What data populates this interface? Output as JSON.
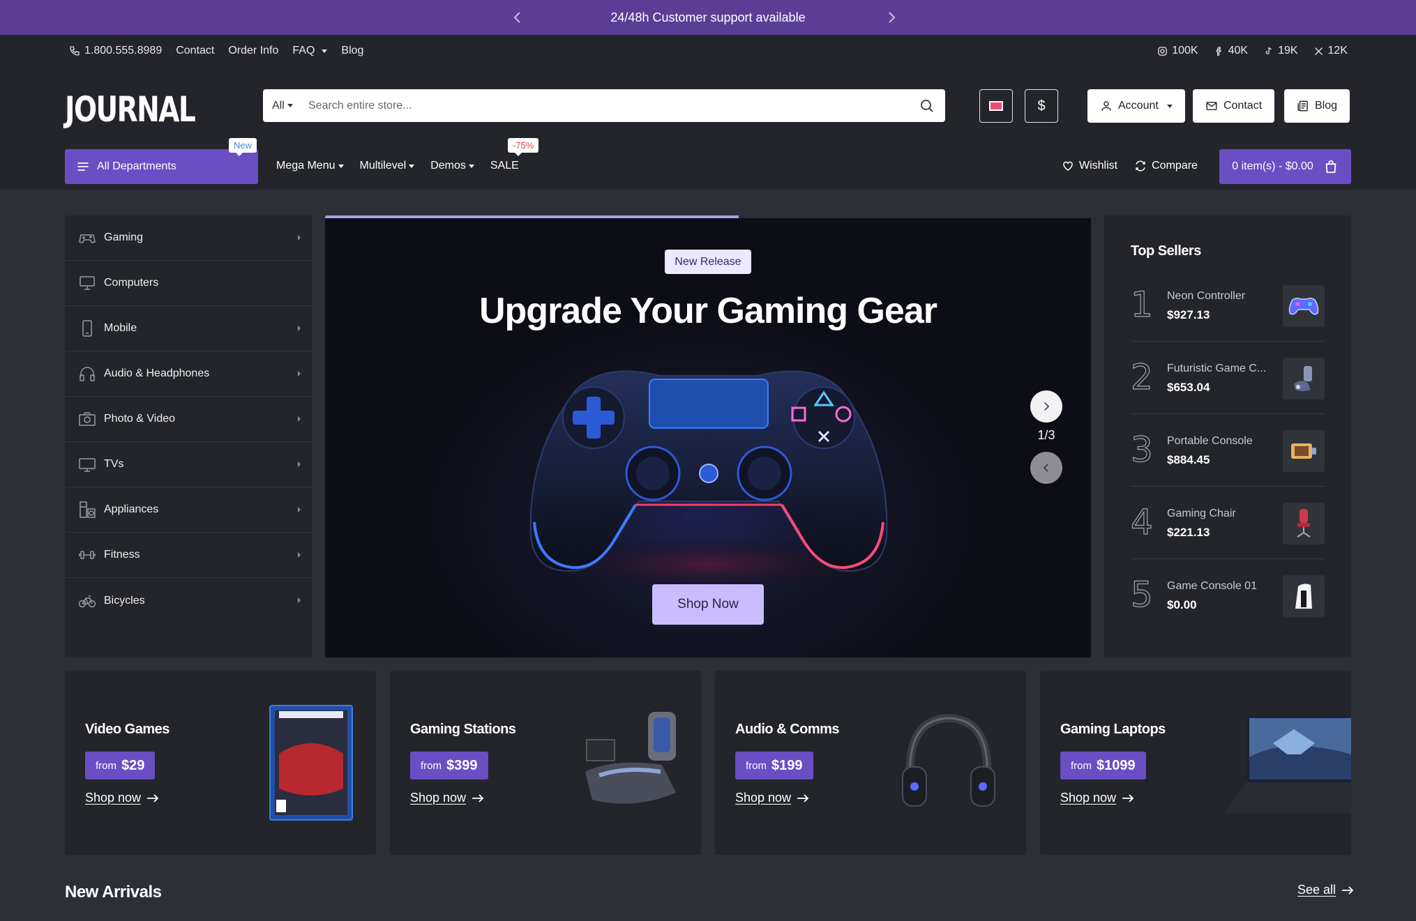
{
  "announcement": {
    "text": "24/48h Customer support available"
  },
  "topbar": {
    "phone": "1.800.555.8989",
    "links": [
      "Contact",
      "Order Info",
      "FAQ",
      "Blog"
    ],
    "social": [
      {
        "icon": "instagram-icon",
        "count": "100K"
      },
      {
        "icon": "facebook-icon",
        "count": "40K"
      },
      {
        "icon": "tiktok-icon",
        "count": "19K"
      },
      {
        "icon": "x-icon",
        "count": "12K"
      }
    ]
  },
  "header": {
    "logo": "JOURNAL",
    "search": {
      "category": "All",
      "placeholder": "Search entire store..."
    },
    "currency": "$",
    "buttons": {
      "account": "Account",
      "contact": "Contact",
      "blog": "Blog"
    }
  },
  "nav": {
    "departments": "All Departments",
    "departments_badge": "New",
    "items": [
      "Mega Menu",
      "Multilevel",
      "Demos",
      "SALE"
    ],
    "sale_badge": "-75%",
    "wishlist": "Wishlist",
    "compare": "Compare",
    "cart": "0 item(s) - $0.00"
  },
  "sidebar": {
    "items": [
      {
        "label": "Gaming",
        "icon": "gamepad-icon"
      },
      {
        "label": "Computers",
        "icon": "desktop-icon"
      },
      {
        "label": "Mobile",
        "icon": "mobile-icon"
      },
      {
        "label": "Audio & Headphones",
        "icon": "headphones-icon"
      },
      {
        "label": "Photo & Video",
        "icon": "camera-icon"
      },
      {
        "label": "TVs",
        "icon": "tv-icon"
      },
      {
        "label": "Appliances",
        "icon": "appliance-icon"
      },
      {
        "label": "Fitness",
        "icon": "dumbbell-icon"
      },
      {
        "label": "Bicycles",
        "icon": "bicycle-icon"
      }
    ]
  },
  "hero": {
    "tag": "New Release",
    "title": "Upgrade Your Gaming Gear",
    "cta": "Shop Now",
    "counter": "1/3",
    "progress": 0.54
  },
  "top_sellers": {
    "title": "Top Sellers",
    "items": [
      {
        "rank": "1",
        "name": "Neon Controller",
        "price": "$927.13"
      },
      {
        "rank": "2",
        "name": "Futuristic Game C...",
        "price": "$653.04"
      },
      {
        "rank": "3",
        "name": "Portable Console",
        "price": "$884.45"
      },
      {
        "rank": "4",
        "name": "Gaming Chair",
        "price": "$221.13"
      },
      {
        "rank": "5",
        "name": "Game Console 01",
        "price": "$0.00"
      }
    ]
  },
  "promos": [
    {
      "title": "Video Games",
      "from": "from",
      "price": "$29",
      "link": "Shop now"
    },
    {
      "title": "Gaming Stations",
      "from": "from",
      "price": "$399",
      "link": "Shop now"
    },
    {
      "title": "Audio & Comms",
      "from": "from",
      "price": "$199",
      "link": "Shop now"
    },
    {
      "title": "Gaming Laptops",
      "from": "from",
      "price": "$1099",
      "link": "Shop now"
    }
  ],
  "new_arrivals": {
    "title": "New Arrivals",
    "see_all": "See all"
  },
  "colors": {
    "accent": "#6a4ec4",
    "announce_bg": "#5a3e96",
    "page_bg": "#2c2f36",
    "panel_bg": "#23252b",
    "hero_cta": "#c9bdff"
  }
}
